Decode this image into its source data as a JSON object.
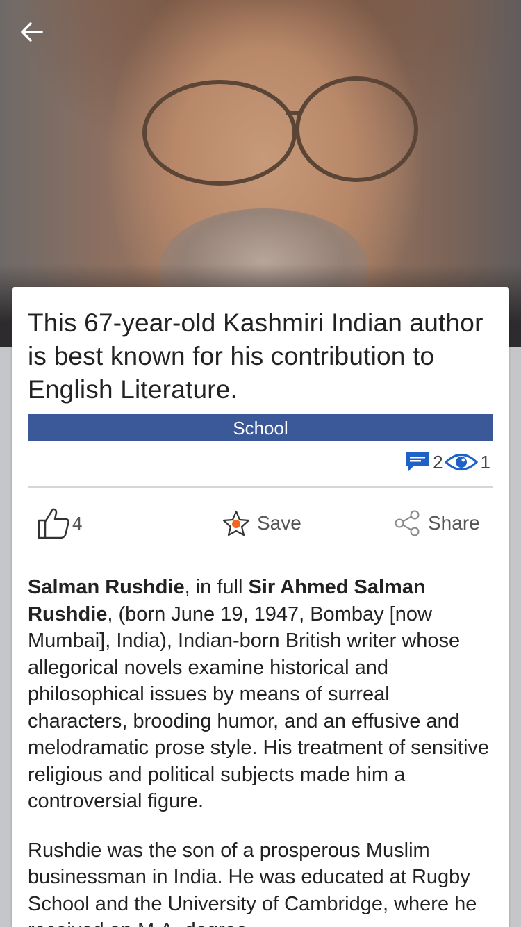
{
  "hero": {
    "image": "portrait-photo"
  },
  "nav": {
    "back_icon": "arrow-left-icon"
  },
  "card": {
    "title": "This 67-year-old Kashmiri Indian author is best known for his contribution to English Literature.",
    "category": "School",
    "category_color": "#3b5998",
    "comments_count": "2",
    "views_count": "1",
    "like_count": "4",
    "save_label": "Save",
    "share_label": "Share",
    "accent_comment": "#1f62c7",
    "accent_star": "#f26522"
  },
  "article": {
    "p1_bold1": "Salman Rushdie",
    "p1_text1": ", in full ",
    "p1_bold2": "Sir Ahmed Salman Rushdie",
    "p1_text2": ", (born June 19, 1947, Bombay [now Mumbai], India), Indian-born British writer whose allegorical novels examine historical and philosophical issues by means of surreal characters, brooding humor, and an effusive and melodramatic prose style. His treatment of sensitive religious and political subjects made him a controversial figure.",
    "p2": "Rushdie was the son of a prosperous Muslim businessman in India. He was educated at Rugby School and the University of Cambridge, where he received an M.A. degree"
  }
}
